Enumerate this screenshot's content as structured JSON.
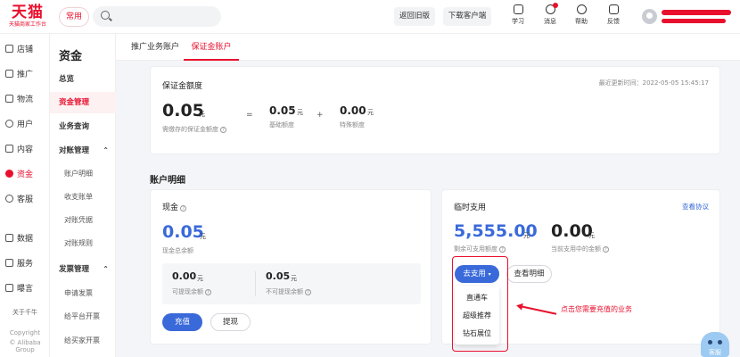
{
  "topbar": {
    "logo_main": "天猫",
    "logo_sub": "天猫商家工作台",
    "common_label": "常用",
    "search_placeholder": "",
    "back_old": "返回旧版",
    "download_client": "下载客户端",
    "icons": [
      {
        "name": "learn",
        "label": "学习"
      },
      {
        "name": "message",
        "label": "消息"
      },
      {
        "name": "help",
        "label": "帮助"
      },
      {
        "name": "feedback",
        "label": "反馈"
      }
    ]
  },
  "sidebar": {
    "items": [
      {
        "label": "店铺",
        "icon": "store-icon"
      },
      {
        "label": "推广",
        "icon": "promotion-icon"
      },
      {
        "label": "物流",
        "icon": "logistics-icon"
      },
      {
        "label": "用户",
        "icon": "user-icon"
      },
      {
        "label": "内容",
        "icon": "content-icon"
      },
      {
        "label": "资金",
        "icon": "fund-icon",
        "active": true
      },
      {
        "label": "客服",
        "icon": "service-icon"
      },
      {
        "label": "数据",
        "icon": "data-icon"
      },
      {
        "label": "服务",
        "icon": "services-icon"
      },
      {
        "label": "曝言",
        "icon": "voice-icon"
      }
    ],
    "about": "关于千牛",
    "copyright_1": "Copyright",
    "copyright_2": "© Alibaba Group"
  },
  "subnav": {
    "title": "资金",
    "items": [
      {
        "label": "总览",
        "kind": "group"
      },
      {
        "label": "资金管理",
        "kind": "group",
        "active": true
      },
      {
        "label": "业务查询",
        "kind": "group"
      },
      {
        "label": "对账管理",
        "kind": "group",
        "caret": "⌃"
      },
      {
        "label": "账户明细",
        "kind": "sub"
      },
      {
        "label": "收支账单",
        "kind": "sub"
      },
      {
        "label": "对账凭据",
        "kind": "sub"
      },
      {
        "label": "对账规则",
        "kind": "sub"
      },
      {
        "label": "发票管理",
        "kind": "group",
        "caret": "⌃"
      },
      {
        "label": "申请发票",
        "kind": "sub"
      },
      {
        "label": "给平台开票",
        "kind": "sub"
      },
      {
        "label": "给买家开票",
        "kind": "sub"
      }
    ]
  },
  "tabs": [
    {
      "label": "推广业务账户"
    },
    {
      "label": "保证金账户",
      "active": true
    }
  ],
  "deposit": {
    "title": "保证金额度",
    "updated": "最近更新时间：2022-05-05 15:45:17",
    "deposit_value": "0.05",
    "deposit_unit": "元",
    "deposit_desc": "需缴存的保证金额度",
    "op_equal": "=",
    "base_value": "0.05",
    "base_unit": "元",
    "base_desc": "基础额度",
    "op_plus": "+",
    "special_value": "0.00",
    "special_unit": "元",
    "special_desc": "特殊额度"
  },
  "account_detail": {
    "title": "账户明细",
    "cash": {
      "title": "现金",
      "total_value": "0.05",
      "total_unit": "元",
      "total_desc": "现金总余额",
      "withdrawable_value": "0.00",
      "withdrawable_unit": "元",
      "withdrawable_desc": "可提现余额",
      "non_withdrawable_value": "0.05",
      "non_withdrawable_unit": "元",
      "non_withdrawable_desc": "不可提现余额",
      "recharge_button": "充值",
      "withdraw_button": "提现"
    },
    "temp": {
      "title": "临时支用",
      "view_agreement": "查看协议",
      "remaining_value": "5,555.00",
      "remaining_unit": "元",
      "remaining_desc": "剩余可支用额度",
      "current_value": "0.00",
      "current_unit": "元",
      "current_desc": "当前支用中的金额",
      "use_button": "去支用",
      "detail_button": "查看明细",
      "dropdown": [
        "直通车",
        "超级推荐",
        "钻石展位"
      ]
    }
  },
  "annotation": {
    "text": "点击您需要充值的业务",
    "color": "#e8102e"
  },
  "float_widget": {
    "label": "客服"
  },
  "colors": {
    "brand": "#e8102e",
    "primary": "#3a6ad9"
  }
}
